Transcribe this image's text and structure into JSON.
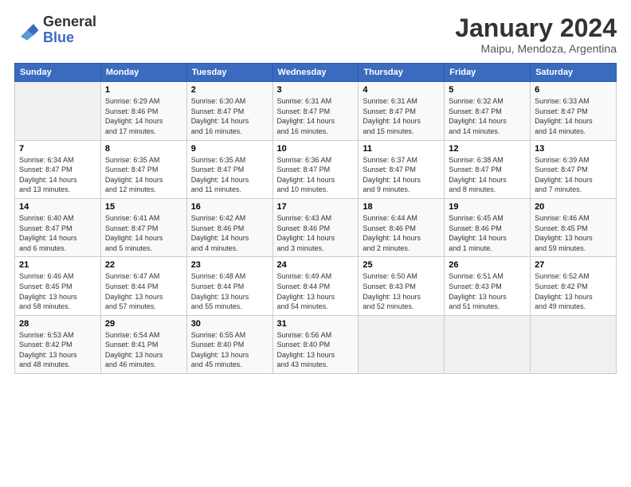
{
  "header": {
    "logo_general": "General",
    "logo_blue": "Blue",
    "month_title": "January 2024",
    "location": "Maipu, Mendoza, Argentina"
  },
  "days_of_week": [
    "Sunday",
    "Monday",
    "Tuesday",
    "Wednesday",
    "Thursday",
    "Friday",
    "Saturday"
  ],
  "weeks": [
    {
      "days": [
        {
          "num": "",
          "info": ""
        },
        {
          "num": "1",
          "info": "Sunrise: 6:29 AM\nSunset: 8:46 PM\nDaylight: 14 hours\nand 17 minutes."
        },
        {
          "num": "2",
          "info": "Sunrise: 6:30 AM\nSunset: 8:47 PM\nDaylight: 14 hours\nand 16 minutes."
        },
        {
          "num": "3",
          "info": "Sunrise: 6:31 AM\nSunset: 8:47 PM\nDaylight: 14 hours\nand 16 minutes."
        },
        {
          "num": "4",
          "info": "Sunrise: 6:31 AM\nSunset: 8:47 PM\nDaylight: 14 hours\nand 15 minutes."
        },
        {
          "num": "5",
          "info": "Sunrise: 6:32 AM\nSunset: 8:47 PM\nDaylight: 14 hours\nand 14 minutes."
        },
        {
          "num": "6",
          "info": "Sunrise: 6:33 AM\nSunset: 8:47 PM\nDaylight: 14 hours\nand 14 minutes."
        }
      ]
    },
    {
      "days": [
        {
          "num": "7",
          "info": "Sunrise: 6:34 AM\nSunset: 8:47 PM\nDaylight: 14 hours\nand 13 minutes."
        },
        {
          "num": "8",
          "info": "Sunrise: 6:35 AM\nSunset: 8:47 PM\nDaylight: 14 hours\nand 12 minutes."
        },
        {
          "num": "9",
          "info": "Sunrise: 6:35 AM\nSunset: 8:47 PM\nDaylight: 14 hours\nand 11 minutes."
        },
        {
          "num": "10",
          "info": "Sunrise: 6:36 AM\nSunset: 8:47 PM\nDaylight: 14 hours\nand 10 minutes."
        },
        {
          "num": "11",
          "info": "Sunrise: 6:37 AM\nSunset: 8:47 PM\nDaylight: 14 hours\nand 9 minutes."
        },
        {
          "num": "12",
          "info": "Sunrise: 6:38 AM\nSunset: 8:47 PM\nDaylight: 14 hours\nand 8 minutes."
        },
        {
          "num": "13",
          "info": "Sunrise: 6:39 AM\nSunset: 8:47 PM\nDaylight: 14 hours\nand 7 minutes."
        }
      ]
    },
    {
      "days": [
        {
          "num": "14",
          "info": "Sunrise: 6:40 AM\nSunset: 8:47 PM\nDaylight: 14 hours\nand 6 minutes."
        },
        {
          "num": "15",
          "info": "Sunrise: 6:41 AM\nSunset: 8:47 PM\nDaylight: 14 hours\nand 5 minutes."
        },
        {
          "num": "16",
          "info": "Sunrise: 6:42 AM\nSunset: 8:46 PM\nDaylight: 14 hours\nand 4 minutes."
        },
        {
          "num": "17",
          "info": "Sunrise: 6:43 AM\nSunset: 8:46 PM\nDaylight: 14 hours\nand 3 minutes."
        },
        {
          "num": "18",
          "info": "Sunrise: 6:44 AM\nSunset: 8:46 PM\nDaylight: 14 hours\nand 2 minutes."
        },
        {
          "num": "19",
          "info": "Sunrise: 6:45 AM\nSunset: 8:46 PM\nDaylight: 14 hours\nand 1 minute."
        },
        {
          "num": "20",
          "info": "Sunrise: 6:46 AM\nSunset: 8:45 PM\nDaylight: 13 hours\nand 59 minutes."
        }
      ]
    },
    {
      "days": [
        {
          "num": "21",
          "info": "Sunrise: 6:46 AM\nSunset: 8:45 PM\nDaylight: 13 hours\nand 58 minutes."
        },
        {
          "num": "22",
          "info": "Sunrise: 6:47 AM\nSunset: 8:44 PM\nDaylight: 13 hours\nand 57 minutes."
        },
        {
          "num": "23",
          "info": "Sunrise: 6:48 AM\nSunset: 8:44 PM\nDaylight: 13 hours\nand 55 minutes."
        },
        {
          "num": "24",
          "info": "Sunrise: 6:49 AM\nSunset: 8:44 PM\nDaylight: 13 hours\nand 54 minutes."
        },
        {
          "num": "25",
          "info": "Sunrise: 6:50 AM\nSunset: 8:43 PM\nDaylight: 13 hours\nand 52 minutes."
        },
        {
          "num": "26",
          "info": "Sunrise: 6:51 AM\nSunset: 8:43 PM\nDaylight: 13 hours\nand 51 minutes."
        },
        {
          "num": "27",
          "info": "Sunrise: 6:52 AM\nSunset: 8:42 PM\nDaylight: 13 hours\nand 49 minutes."
        }
      ]
    },
    {
      "days": [
        {
          "num": "28",
          "info": "Sunrise: 6:53 AM\nSunset: 8:42 PM\nDaylight: 13 hours\nand 48 minutes."
        },
        {
          "num": "29",
          "info": "Sunrise: 6:54 AM\nSunset: 8:41 PM\nDaylight: 13 hours\nand 46 minutes."
        },
        {
          "num": "30",
          "info": "Sunrise: 6:55 AM\nSunset: 8:40 PM\nDaylight: 13 hours\nand 45 minutes."
        },
        {
          "num": "31",
          "info": "Sunrise: 6:56 AM\nSunset: 8:40 PM\nDaylight: 13 hours\nand 43 minutes."
        },
        {
          "num": "",
          "info": ""
        },
        {
          "num": "",
          "info": ""
        },
        {
          "num": "",
          "info": ""
        }
      ]
    }
  ]
}
